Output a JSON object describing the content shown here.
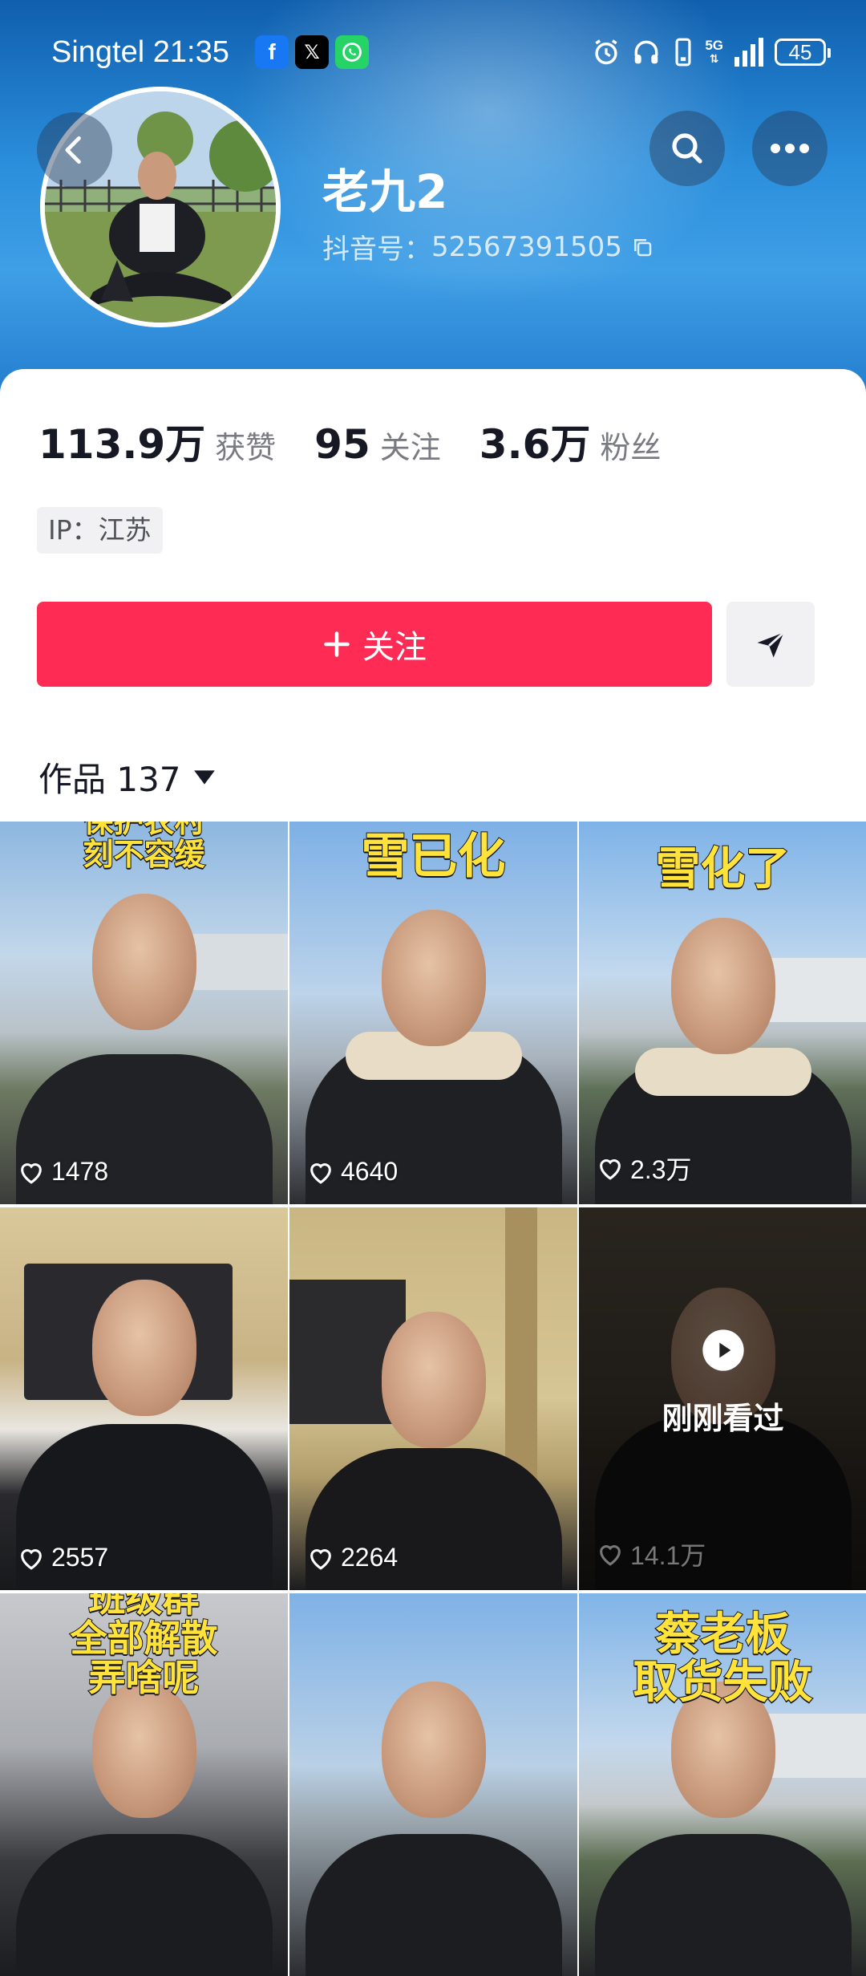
{
  "status_bar": {
    "carrier": "Singtel",
    "time": "21:35",
    "network": "5G",
    "battery": "45",
    "apps": [
      {
        "name": "facebook-icon",
        "glyph": "f",
        "color": "#1877f2"
      },
      {
        "name": "x-icon",
        "glyph": "X",
        "color": "#000000"
      },
      {
        "name": "whatsapp-icon",
        "glyph": "✆",
        "color": "#25d366"
      }
    ]
  },
  "profile": {
    "name": "老九2",
    "id_label": "抖音号：",
    "id_value": "52567391505",
    "ip": "IP：江苏"
  },
  "stats": [
    {
      "value": "113.9万",
      "label": "获赞"
    },
    {
      "value": "95",
      "label": "关注"
    },
    {
      "value": "3.6万",
      "label": "粉丝"
    }
  ],
  "actions": {
    "follow_label": "关注",
    "accent": "#fe2c55"
  },
  "works_tab": {
    "label": "作品 137"
  },
  "videos": [
    {
      "caption": "保护农村\n刻不容缓",
      "likes": "1478"
    },
    {
      "caption": "雪已化",
      "likes": "4640"
    },
    {
      "caption": "雪化了",
      "likes": "2.3万"
    },
    {
      "caption": "",
      "likes": "2557"
    },
    {
      "caption": "",
      "likes": "2264"
    },
    {
      "caption": "",
      "likes": "14.1万",
      "overlay": "刚刚看过"
    },
    {
      "caption": "班级群\n全部解散\n弄啥呢",
      "likes": ""
    },
    {
      "caption": "",
      "likes": ""
    },
    {
      "caption": "蔡老板\n取货失败",
      "likes": ""
    }
  ]
}
